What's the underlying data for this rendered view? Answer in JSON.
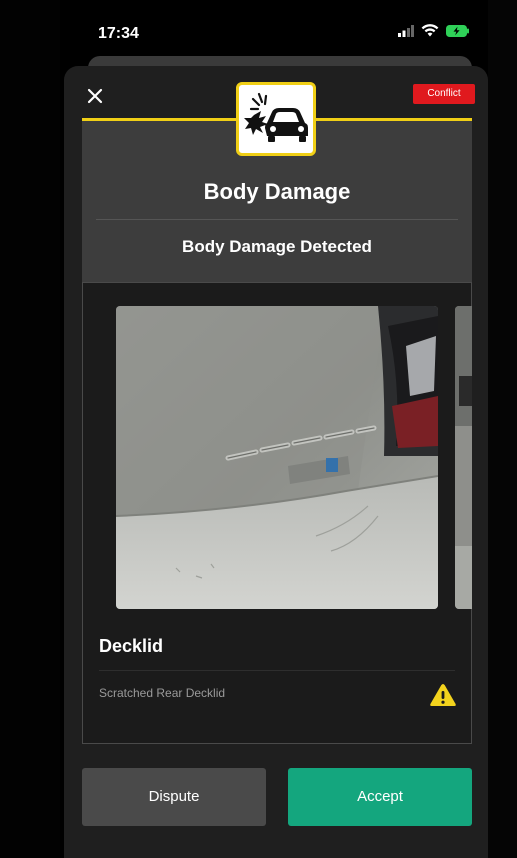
{
  "status_bar": {
    "time": "17:34"
  },
  "header": {
    "close_icon": "close-icon",
    "badge": "Conflict",
    "category_icon": "car-collision-icon",
    "title": "Body Damage",
    "subtitle": "Body Damage Detected"
  },
  "damage_item": {
    "part": "Decklid",
    "description": "Scratched Rear Decklid",
    "severity_icon": "warning-icon"
  },
  "actions": {
    "dispute_label": "Dispute",
    "accept_label": "Accept"
  },
  "colors": {
    "accent": "#f0cf16",
    "badge": "#e0191e",
    "accept": "#14a67e",
    "dispute": "#4a4a4a"
  }
}
